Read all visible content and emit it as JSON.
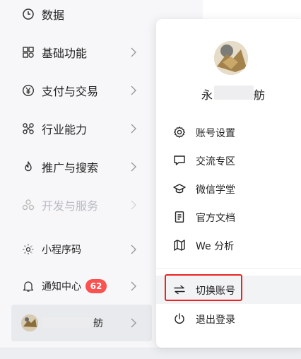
{
  "colors": {
    "sidebar_bg": "#f7f7f9",
    "badge_bg": "#fa5151",
    "highlight_border": "#ee2222",
    "disabled_text": "#b9bcc2"
  },
  "sidebar": {
    "items": [
      {
        "label": "数据",
        "icon": "clock-icon"
      },
      {
        "label": "基础功能",
        "icon": "grid-icon"
      },
      {
        "label": "支付与交易",
        "icon": "yen-circle-icon"
      },
      {
        "label": "行业能力",
        "icon": "nodes-icon"
      },
      {
        "label": "推广与搜索",
        "icon": "flame-icon"
      },
      {
        "label": "开发与服务",
        "icon": "cluster-icon",
        "disabled": true
      },
      {
        "label": "小程序码",
        "icon": "sun-dots-icon"
      },
      {
        "label": "通知中心",
        "icon": "bell-icon",
        "badge": "62"
      }
    ],
    "account": {
      "name_tail": "舫",
      "icon": "avatar"
    }
  },
  "popup": {
    "name_head": "永",
    "name_tail": "舫",
    "menu": [
      {
        "label": "账号设置",
        "icon": "gear-icon"
      },
      {
        "label": "交流专区",
        "icon": "chat-bubble-icon"
      },
      {
        "label": "微信学堂",
        "icon": "graduation-cap-icon"
      },
      {
        "label": "官方文档",
        "icon": "document-icon"
      },
      {
        "label": "We 分析",
        "icon": "map-icon"
      },
      {
        "label": "切换账号",
        "icon": "switch-arrows-icon",
        "highlighted": true
      },
      {
        "label": "退出登录",
        "icon": "power-icon"
      }
    ]
  }
}
